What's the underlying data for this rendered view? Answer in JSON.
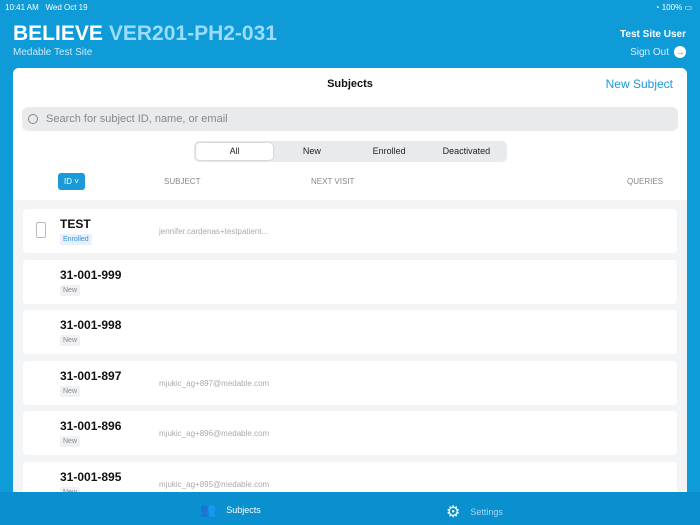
{
  "status": {
    "time": "10:41 AM",
    "date": "Wed Oct 19",
    "battery": "100%"
  },
  "header": {
    "study": "BELIEVE",
    "code": "VER201-PH2-031",
    "site": "Medable Test Site",
    "user": "Test Site User",
    "sign_out": "Sign Out"
  },
  "panel": {
    "title": "Subjects",
    "new_subject": "New Subject",
    "search_placeholder": "Search for subject ID, name, or email",
    "filters": [
      "All",
      "New",
      "Enrolled",
      "Deactivated"
    ],
    "sort_label": "ID",
    "columns": {
      "subject": "SUBJECT",
      "next_visit": "NEXT VISIT",
      "queries": "QUERIES"
    },
    "rows": [
      {
        "id": "TEST",
        "status": "Enrolled",
        "email": "jennifer.cardenas+testpatient..."
      },
      {
        "id": "31-001-999",
        "status": "New",
        "email": ""
      },
      {
        "id": "31-001-998",
        "status": "New",
        "email": ""
      },
      {
        "id": "31-001-897",
        "status": "New",
        "email": "mjukic_ag+897@medable.com"
      },
      {
        "id": "31-001-896",
        "status": "New",
        "email": "mjukic_ag+896@medable.com"
      },
      {
        "id": "31-001-895",
        "status": "New",
        "email": "mjukic_ag+895@medable.com"
      }
    ]
  },
  "tabs": {
    "subjects": "Subjects",
    "settings": "Settings"
  }
}
